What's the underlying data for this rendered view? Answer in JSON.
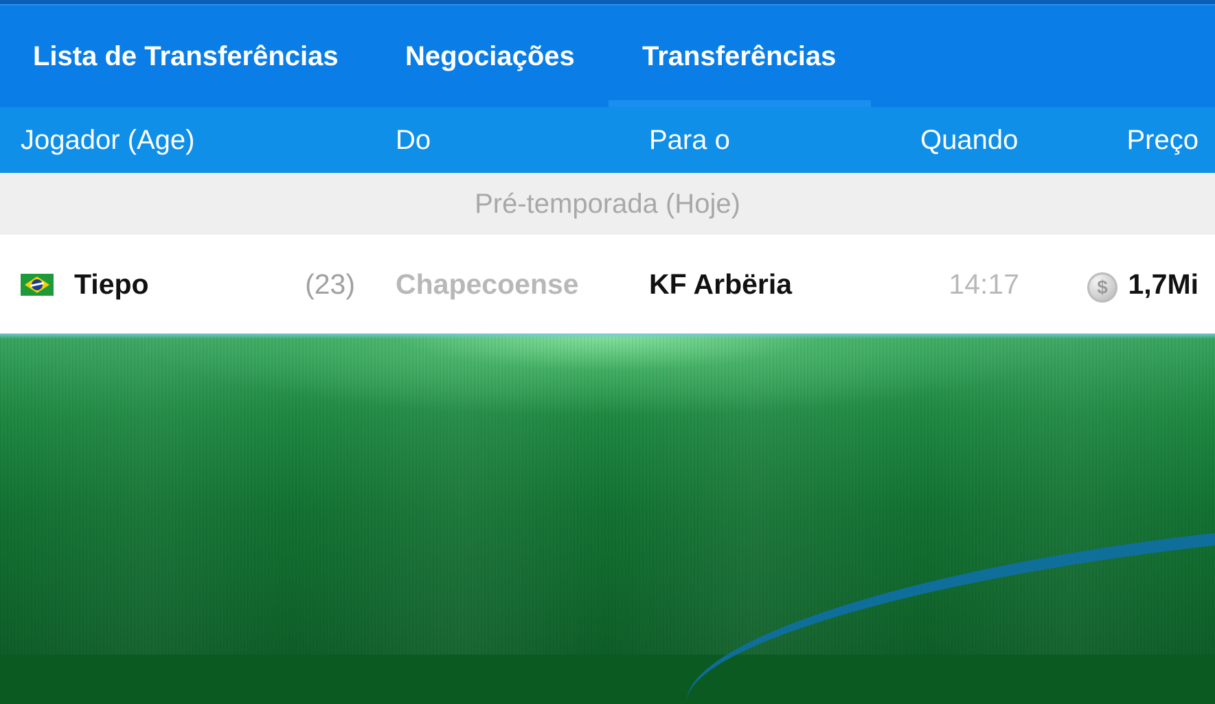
{
  "tabs": [
    {
      "label": "Lista de Transferências",
      "active": false
    },
    {
      "label": "Negociações",
      "active": false
    },
    {
      "label": "Transferências",
      "active": true
    }
  ],
  "table": {
    "headers": {
      "player": "Jogador (Age)",
      "from": "Do",
      "to": "Para o",
      "when": "Quando",
      "price": "Preço"
    },
    "group": "Pré-temporada (Hoje)",
    "rows": [
      {
        "flag": "brazil-flag-icon",
        "name": "Tiepo",
        "age": "(23)",
        "from": "Chapecoense",
        "to": "KF Arbëria",
        "when": "14:17",
        "price_icon": "coin-icon",
        "price": "1,7Mi"
      }
    ]
  },
  "colors": {
    "tabbar": "#0a7ee6",
    "header": "#0f8fe8",
    "group_bg": "#efefef"
  }
}
